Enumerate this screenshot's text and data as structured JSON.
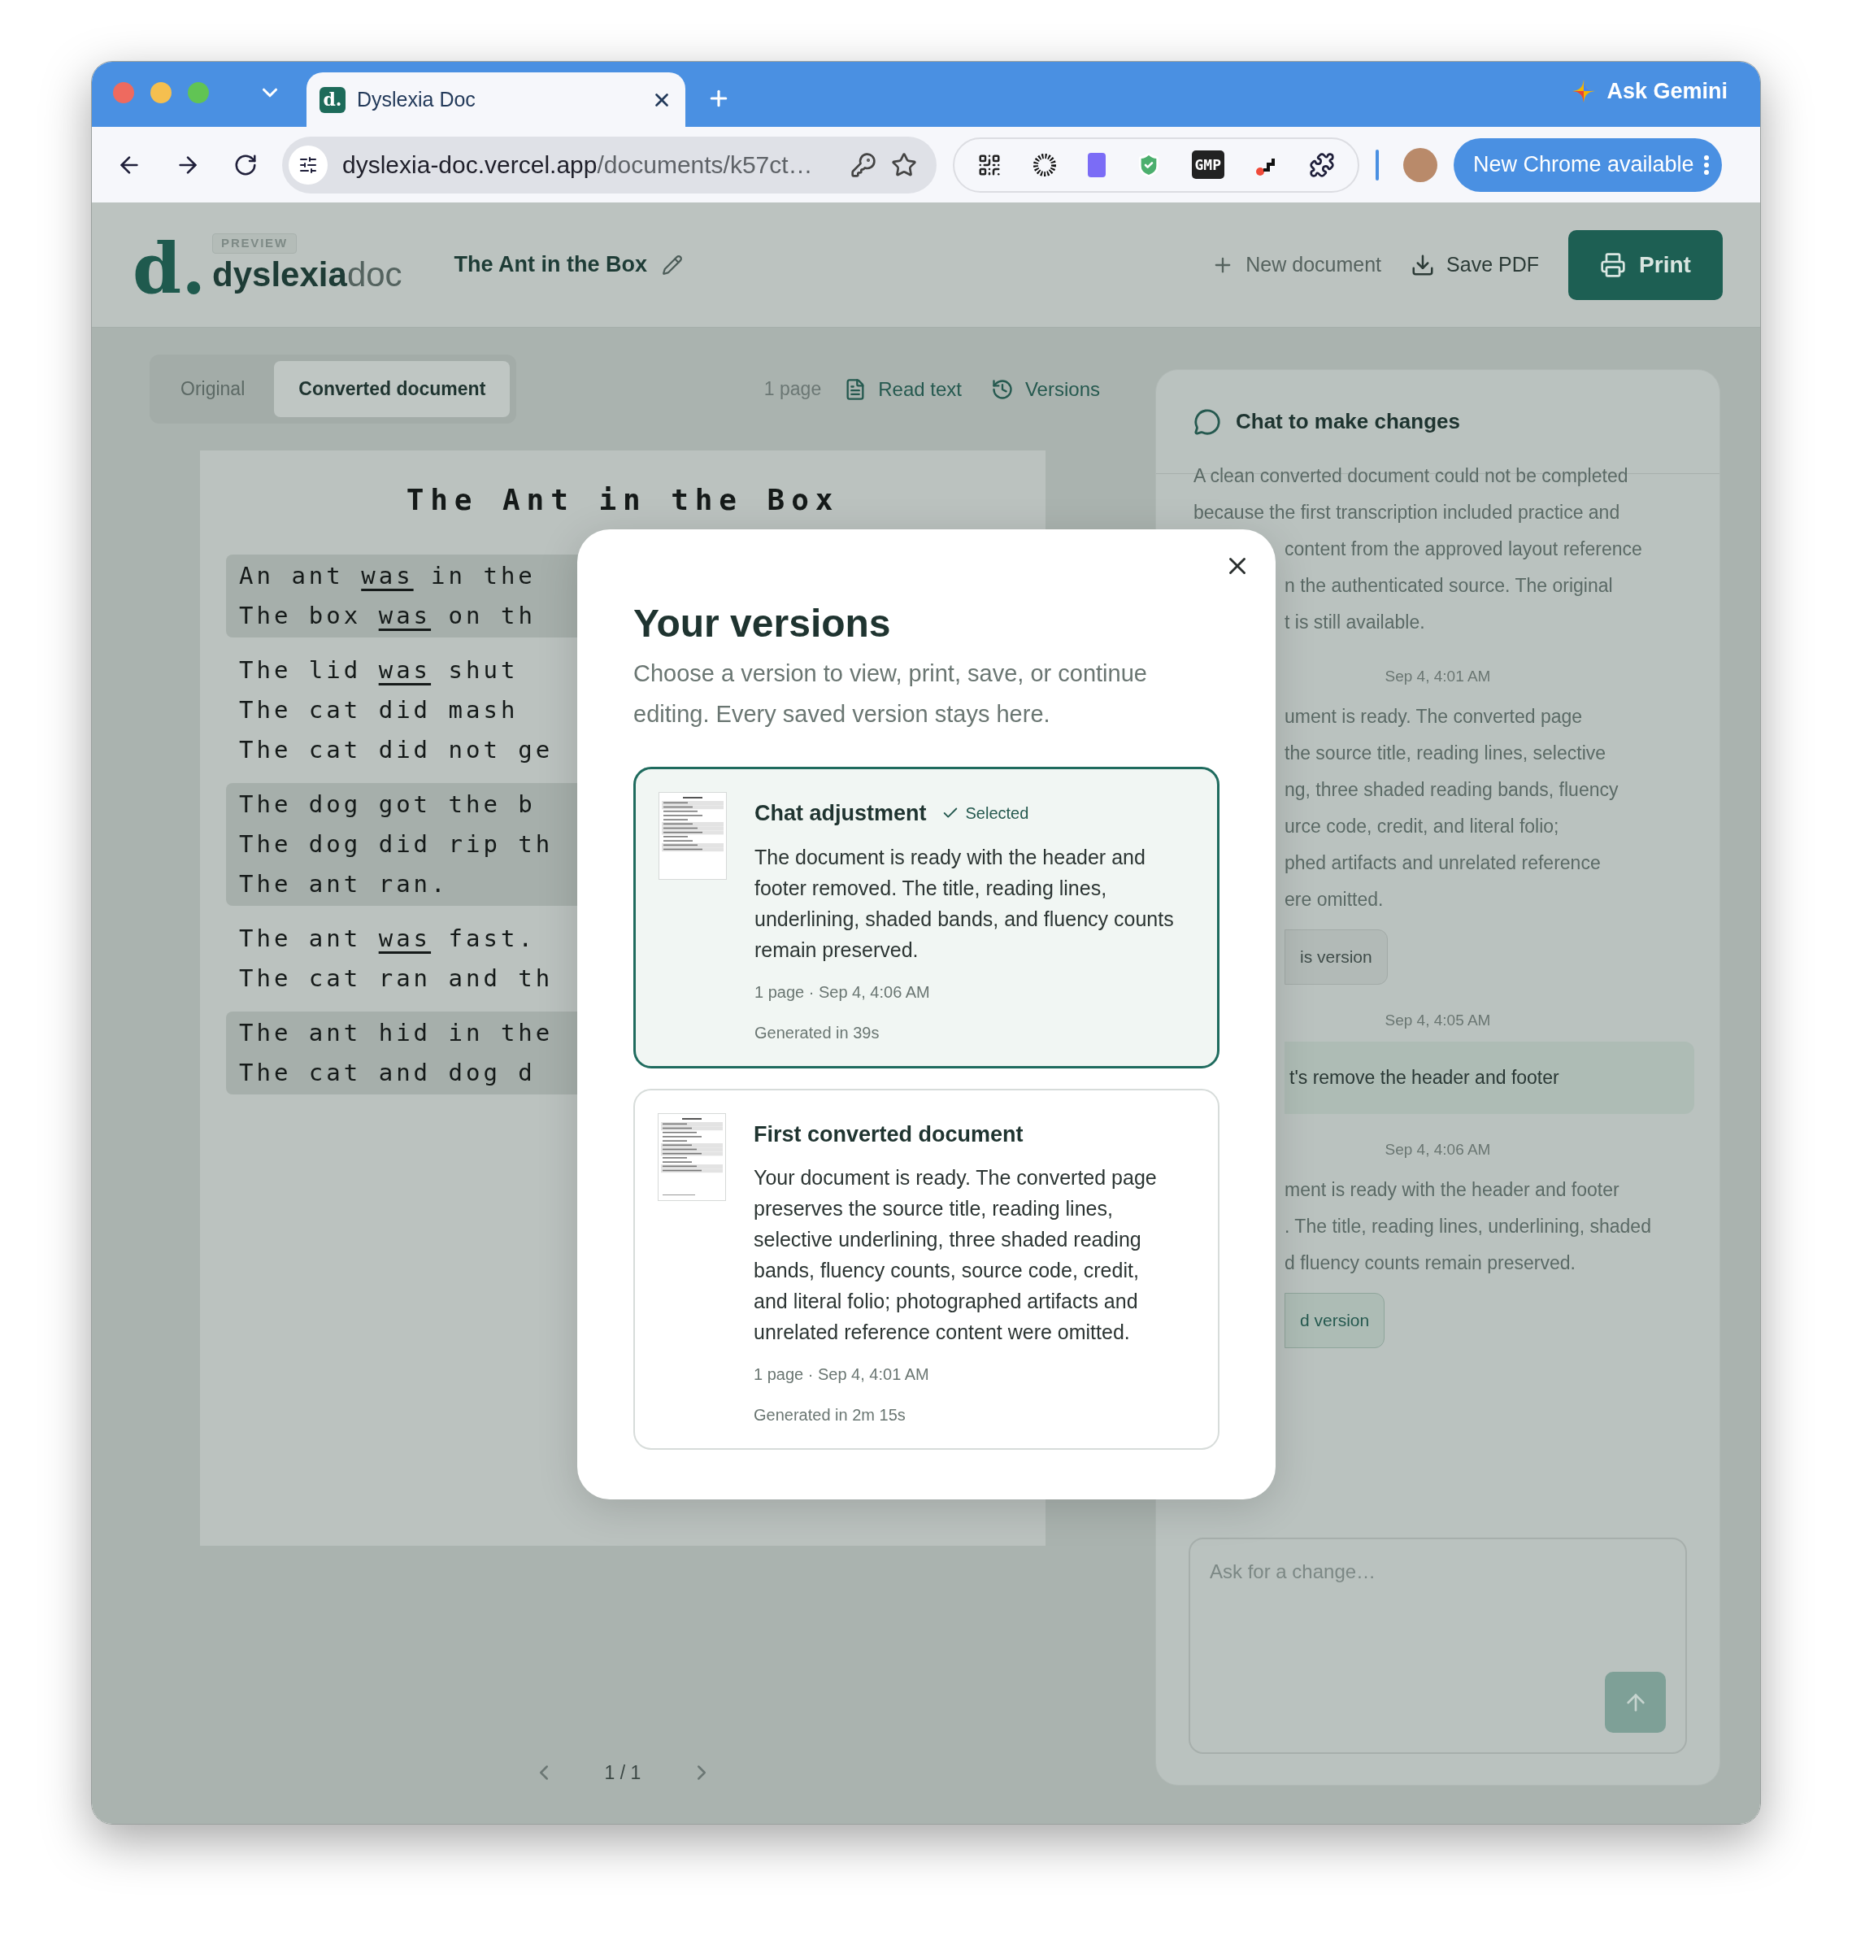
{
  "browser": {
    "tab": {
      "title": "Dyslexia Doc",
      "favicon": "d."
    },
    "ask_gemini": "Ask Gemini",
    "url": {
      "host": "dyslexia-doc.vercel.app",
      "path": "/documents/k57ct…"
    },
    "extension_badge": "GMP",
    "update_button": "New Chrome available"
  },
  "header": {
    "logo_mark": "d.",
    "badge": "PREVIEW",
    "logo_bold": "dyslexia",
    "logo_light": "doc",
    "doc_title": "The Ant in the Box",
    "actions": [
      {
        "label": "New document",
        "kind": "new"
      },
      {
        "label": "Save PDF",
        "kind": "save"
      }
    ],
    "print": "Print"
  },
  "view_tabs": [
    {
      "label": "Original",
      "selected": false
    },
    {
      "label": "Converted document",
      "selected": true
    }
  ],
  "doc_toolbar": {
    "pages": "1 page",
    "read_text": "Read text",
    "versions": "Versions"
  },
  "document": {
    "title": "The Ant in the Box",
    "bands": [
      {
        "shaded": true,
        "lines": [
          [
            {
              "text": "An ant ",
              "underlined": false
            },
            {
              "text": "was",
              "underlined": true
            },
            {
              "text": " in the",
              "underlined": false
            }
          ],
          [
            {
              "text": "The box ",
              "underlined": false
            },
            {
              "text": "was",
              "underlined": true
            },
            {
              "text": " on th",
              "underlined": false
            }
          ]
        ]
      },
      {
        "shaded": false,
        "lines": [
          [
            {
              "text": "The lid ",
              "underlined": false
            },
            {
              "text": "was",
              "underlined": true
            },
            {
              "text": " shut",
              "underlined": false
            }
          ],
          [
            {
              "text": "The cat did mash",
              "underlined": false
            }
          ],
          [
            {
              "text": "The cat did not ge",
              "underlined": false
            }
          ]
        ]
      },
      {
        "shaded": true,
        "lines": [
          [
            {
              "text": "The dog got the b",
              "underlined": false
            }
          ],
          [
            {
              "text": "The dog did rip th",
              "underlined": false
            }
          ],
          [
            {
              "text": "The ant ran.",
              "underlined": false
            }
          ]
        ]
      },
      {
        "shaded": false,
        "lines": [
          [
            {
              "text": "The ant ",
              "underlined": false
            },
            {
              "text": "was",
              "underlined": true
            },
            {
              "text": " fast.",
              "underlined": false
            }
          ],
          [
            {
              "text": "The cat ran and th",
              "underlined": false
            }
          ]
        ]
      },
      {
        "shaded": true,
        "lines": [
          [
            {
              "text": "The ant hid in the",
              "underlined": false
            }
          ],
          [
            {
              "text": "The cat and dog d",
              "underlined": false
            }
          ]
        ]
      }
    ]
  },
  "pagination": {
    "label": "1 / 1"
  },
  "chat": {
    "title": "Chat to make changes",
    "placeholder": "Ask for a change…",
    "messages": [
      {
        "kind": "assistant",
        "lines": [
          {
            "text": "A clean converted document could not be completed",
            "clipped": false
          },
          {
            "text": "because the first transcription included practice and",
            "clipped": false
          },
          {
            "text": "content from the approved layout reference",
            "clipped": true
          },
          {
            "text": "n the authenticated source. The original",
            "clipped": true
          },
          {
            "text": "t is still available.",
            "clipped": true
          }
        ]
      },
      {
        "kind": "timestamp",
        "text": "Sep 4, 4:01 AM"
      },
      {
        "kind": "assistant",
        "lines": [
          {
            "text": "ument is ready. The converted page",
            "clipped": true
          },
          {
            "text": "the source title, reading lines, selective",
            "clipped": true
          },
          {
            "text": "ng, three shaded reading bands, fluency",
            "clipped": true
          },
          {
            "text": "urce code, credit, and literal folio;",
            "clipped": true
          },
          {
            "text": "phed artifacts and unrelated reference",
            "clipped": true
          },
          {
            "text": "ere omitted.",
            "clipped": true
          }
        ]
      },
      {
        "kind": "button",
        "text": "is version",
        "highlighted": false
      },
      {
        "kind": "timestamp",
        "text": "Sep 4, 4:05 AM"
      },
      {
        "kind": "user",
        "text": "t's remove the header and footer"
      },
      {
        "kind": "timestamp",
        "text": "Sep 4, 4:06 AM"
      },
      {
        "kind": "assistant",
        "lines": [
          {
            "text": "ment is ready with the header and footer",
            "clipped": true
          },
          {
            "text": ". The title, reading lines, underlining, shaded",
            "clipped": true
          },
          {
            "text": "d fluency counts remain preserved.",
            "clipped": true
          }
        ]
      },
      {
        "kind": "button",
        "text": "d version",
        "highlighted": true
      }
    ]
  },
  "versions_dialog": {
    "title": "Your versions",
    "subtitle": "Choose a version to view, print, save, or continue editing. Every saved version stays here.",
    "selected_label": "Selected",
    "versions": [
      {
        "name": "Chat adjustment",
        "selected": true,
        "summary": "The document is ready with the header and footer removed. The title, reading lines, underlining, shaded bands, and fluency counts remain preserved.",
        "meta": "1 page · Sep 4, 4:06 AM",
        "generated": "Generated in 39s"
      },
      {
        "name": "First converted document",
        "selected": false,
        "summary": "Your document is ready. The converted page preserves the source title, reading lines, selective underlining, three shaded reading bands, fluency counts, source code, credit, and literal folio; photographed artifacts and unrelated reference content were omitted.",
        "meta": "1 page · Sep 4, 4:01 AM",
        "generated": "Generated in 2m 15s"
      }
    ]
  }
}
